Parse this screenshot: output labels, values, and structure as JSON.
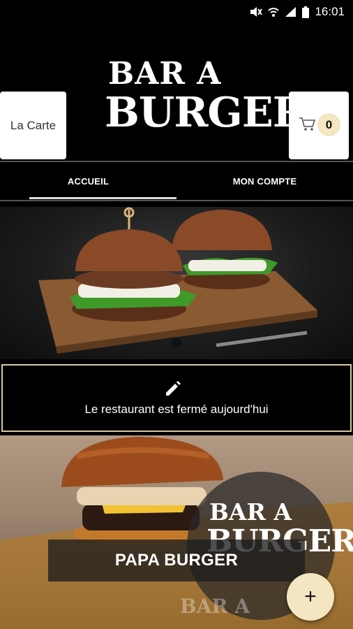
{
  "status_bar": {
    "time": "16:01",
    "icons": [
      "mute-icon",
      "wifi-icon",
      "signal-icon",
      "battery-icon"
    ]
  },
  "header": {
    "menu_button_label": "La Carte",
    "logo_line1": "BAR A",
    "logo_line2": "BURGER",
    "cart_icon": "cart-icon",
    "cart_count": "0"
  },
  "tabs": [
    {
      "label": "ACCUEIL",
      "active": true
    },
    {
      "label": "MON COMPTE",
      "active": false
    }
  ],
  "notice": {
    "icon": "pencil-icon",
    "text": "Le restaurant est fermé aujourd'hui"
  },
  "product": {
    "name": "PAPA BURGER",
    "logo_line1": "BAR A",
    "logo_line2": "BURGER",
    "watermark": "BAR A",
    "add_icon": "plus-icon",
    "add_label": "+"
  },
  "colors": {
    "accent": "#f3e6c0",
    "border": "#d8c9a3",
    "background": "#000000"
  }
}
